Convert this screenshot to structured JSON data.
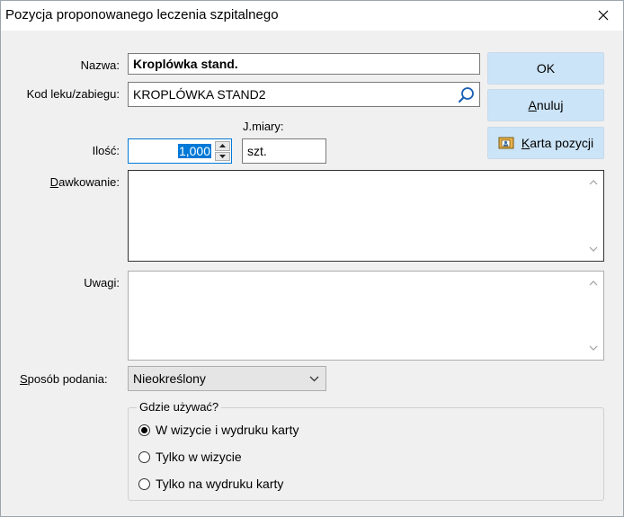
{
  "window": {
    "title": "Pozycja proponowanego leczenia szpitalnego"
  },
  "form": {
    "nazwa_label": "Nazwa:",
    "nazwa_value": "Kroplówka stand.",
    "kod_label": "Kod leku/zabiegu:",
    "kod_value": "KROPLÓWKA STAND2",
    "ilosc_label": "Ilość:",
    "ilosc_value": "1,000",
    "jmiary_label": "J.miary:",
    "jmiary_value": "szt.",
    "dawkowanie_label": "Dawkowanie:",
    "dawkowanie_value": "",
    "uwagi_label": "Uwagi:",
    "uwagi_value": "",
    "sposob_label": "Sposób podania:",
    "sposob_value": "Nieokreślony"
  },
  "buttons": {
    "ok": "OK",
    "anuluj": "Anuluj",
    "karta": "Karta pozycji"
  },
  "where_group": {
    "title": "Gdzie używać?",
    "options": [
      {
        "label": "W wizycie i wydruku karty",
        "selected": true
      },
      {
        "label": "Tylko w wizycie",
        "selected": false
      },
      {
        "label": "Tylko na wydruku karty",
        "selected": false
      }
    ]
  },
  "icons": [
    "close-icon",
    "search-icon",
    "spin-up-icon",
    "spin-down-icon",
    "card-icon",
    "chevron-down-icon",
    "scroll-up-icon",
    "scroll-down-icon"
  ],
  "colors": {
    "button_bg": "#cce4f7",
    "dialog_bg": "#f0f0f0",
    "selection": "#0078d7"
  }
}
